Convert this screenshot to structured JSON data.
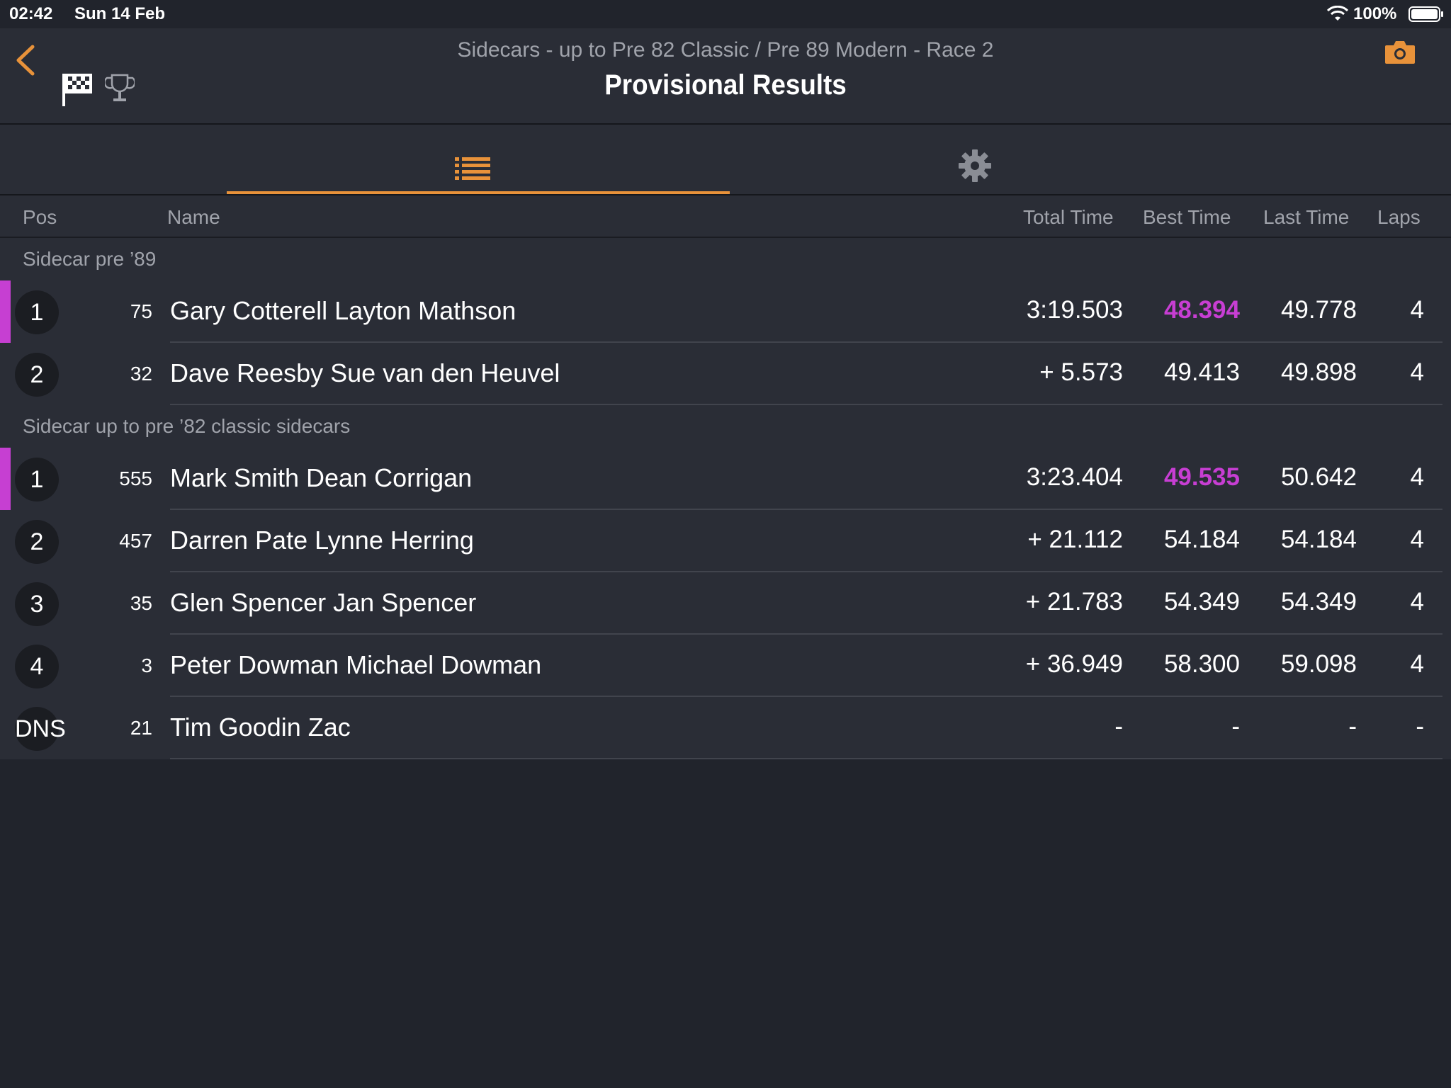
{
  "status_bar": {
    "time": "02:42",
    "date": "Sun 14 Feb",
    "battery": "100%"
  },
  "header": {
    "subtitle": "Sidecars - up to Pre 82 Classic / Pre 89 Modern - Race 2",
    "title": "Provisional Results"
  },
  "icons": [
    "chevron-left-icon",
    "checkered-flag-icon",
    "trophy-icon",
    "camera-icon",
    "list-icon",
    "gear-icon",
    "wifi-icon",
    "battery-icon"
  ],
  "colors": {
    "accent": "#e8923a",
    "fastest": "#c73ed3",
    "background": "#21242c",
    "panel": "#2a2d36"
  },
  "columns": {
    "pos": "Pos",
    "name": "Name",
    "total": "Total Time",
    "best": "Best Time",
    "last": "Last Time",
    "laps": "Laps"
  },
  "groups": [
    {
      "label": "Sidecar pre ’89",
      "rows": [
        {
          "pos": "1",
          "num": "75",
          "name": "Gary Cotterell Layton Mathson",
          "total": "3:19.503",
          "best": "48.394",
          "last": "49.778",
          "laps": "4",
          "fastest": true
        },
        {
          "pos": "2",
          "num": "32",
          "name": "Dave Reesby Sue van den Heuvel",
          "total": "+ 5.573",
          "best": "49.413",
          "last": "49.898",
          "laps": "4",
          "fastest": false
        }
      ]
    },
    {
      "label": "Sidecar up to pre ’82 classic sidecars",
      "rows": [
        {
          "pos": "1",
          "num": "555",
          "name": "Mark Smith Dean Corrigan",
          "total": "3:23.404",
          "best": "49.535",
          "last": "50.642",
          "laps": "4",
          "fastest": true
        },
        {
          "pos": "2",
          "num": "457",
          "name": "Darren Pate Lynne Herring",
          "total": "+ 21.112",
          "best": "54.184",
          "last": "54.184",
          "laps": "4",
          "fastest": false
        },
        {
          "pos": "3",
          "num": "35",
          "name": "Glen Spencer Jan Spencer",
          "total": "+ 21.783",
          "best": "54.349",
          "last": "54.349",
          "laps": "4",
          "fastest": false
        },
        {
          "pos": "4",
          "num": "3",
          "name": "Peter Dowman Michael Dowman",
          "total": "+ 36.949",
          "best": "58.300",
          "last": "59.098",
          "laps": "4",
          "fastest": false
        },
        {
          "pos": "DNS",
          "num": "21",
          "name": "Tim Goodin Zac",
          "total": "-",
          "best": "-",
          "last": "-",
          "laps": "-",
          "fastest": false
        }
      ]
    }
  ]
}
